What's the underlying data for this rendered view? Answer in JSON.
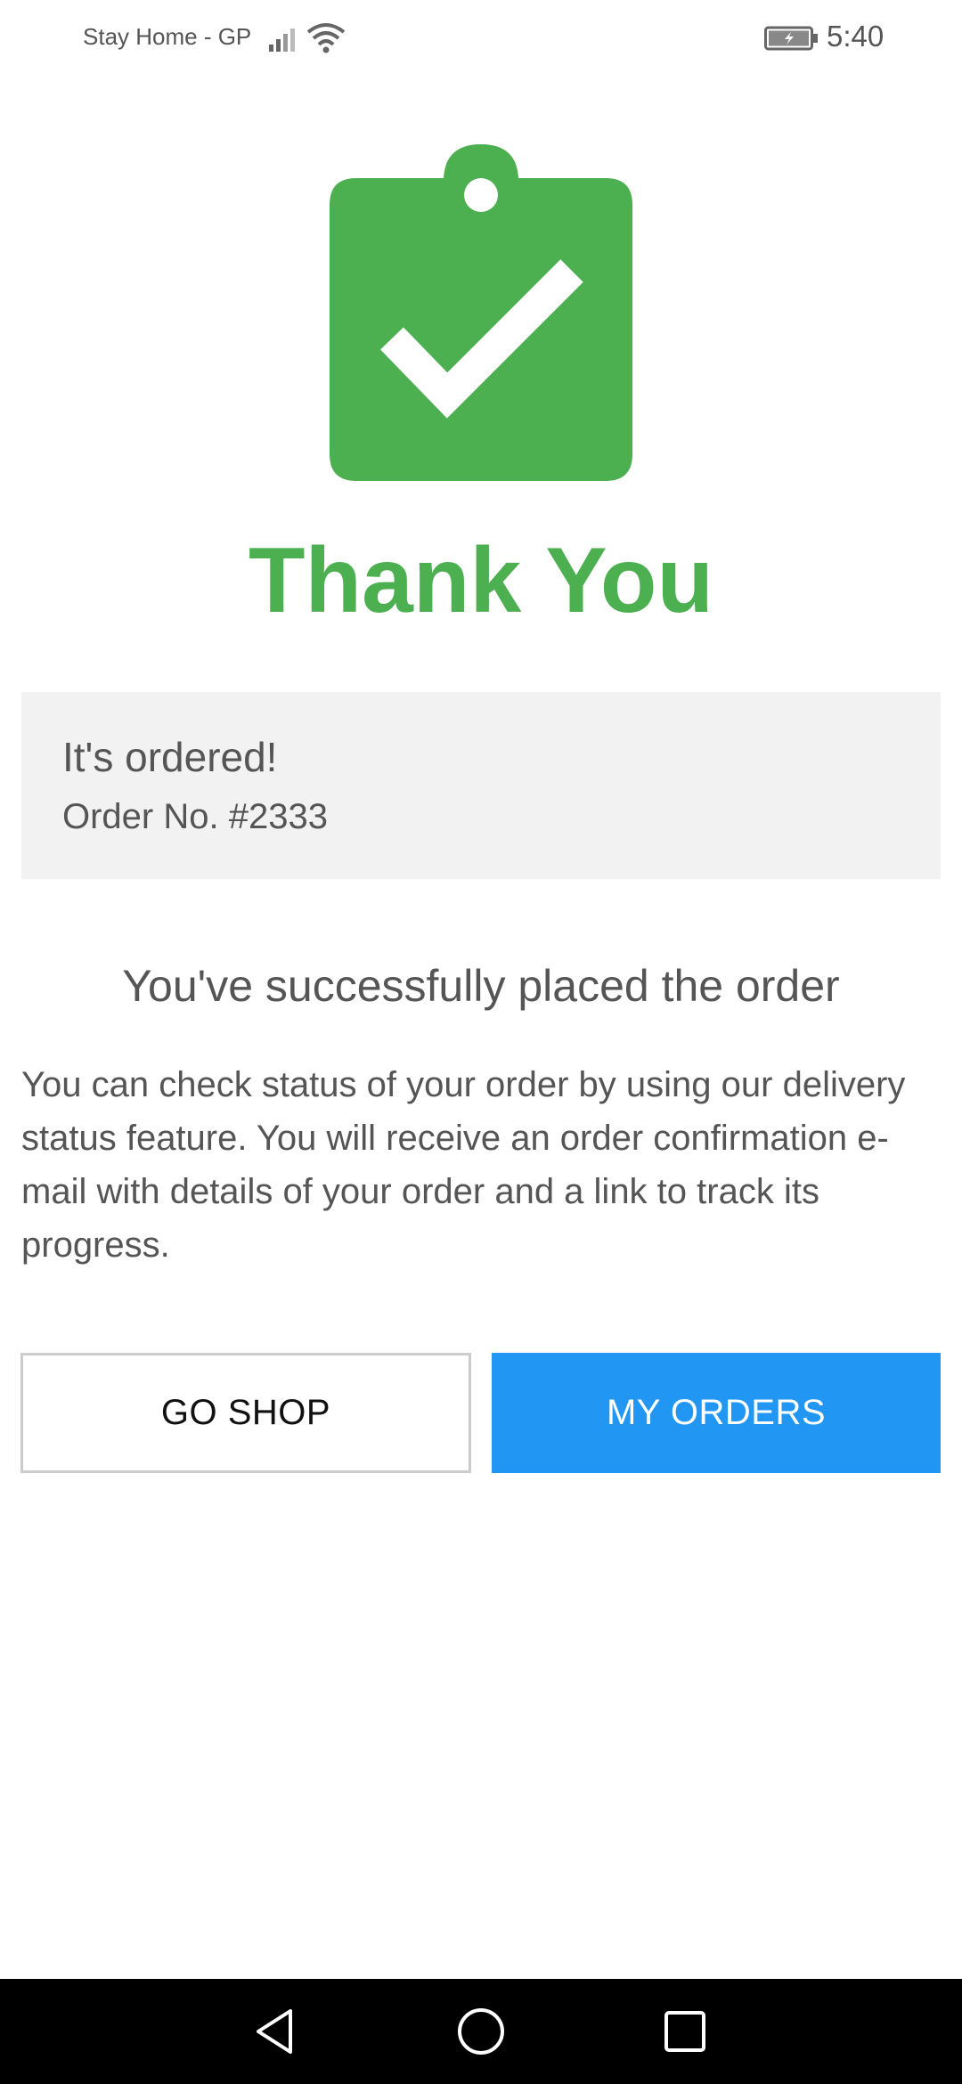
{
  "status_bar": {
    "carrier": "Stay Home - GP",
    "time": "5:40",
    "icons": [
      "signal-icon",
      "wifi-icon",
      "battery-icon"
    ]
  },
  "hero": {
    "icon": "clipboard-check-icon",
    "title": "Thank You"
  },
  "order_card": {
    "title": "It's ordered!",
    "order_number": "Order No. #2333"
  },
  "message": {
    "heading": "You've successfully placed the order",
    "body": "You can check status of your order by using our delivery status feature. You will receive an order confirmation e-mail with details of your order and a link to track its progress."
  },
  "actions": {
    "go_shop_label": "GO SHOP",
    "my_orders_label": "MY ORDERS"
  },
  "nav_bar": {
    "icons": [
      "back-icon",
      "home-icon",
      "recent-apps-icon"
    ]
  },
  "colors": {
    "accent_green": "#4caf50",
    "primary_blue": "#2196f3",
    "card_bg": "#f2f2f2",
    "text_gray": "#555555"
  }
}
